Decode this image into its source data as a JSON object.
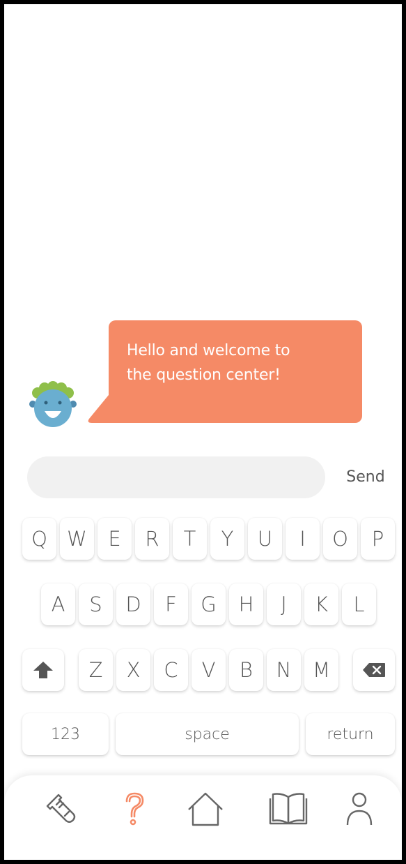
{
  "chat": {
    "bot_avatar_icon": "smiling-bot-avatar-icon",
    "bubble_line1": "Hello and welcome to",
    "bubble_line2": "the question center!",
    "bubble_color": "#f58a66"
  },
  "composer": {
    "input_value": "",
    "input_placeholder": "",
    "send_label": "Send"
  },
  "keyboard": {
    "row1": [
      "Q",
      "W",
      "E",
      "R",
      "T",
      "Y",
      "U",
      "I",
      "O",
      "P"
    ],
    "row2": [
      "A",
      "S",
      "D",
      "F",
      "G",
      "H",
      "J",
      "K",
      "L"
    ],
    "row3": [
      "Z",
      "X",
      "C",
      "V",
      "B",
      "N",
      "M"
    ],
    "shift_icon": "shift-icon",
    "backspace_icon": "backspace-icon",
    "numbers_label": "123",
    "space_label": "space",
    "return_label": "return"
  },
  "bottom_nav": {
    "items": [
      {
        "icon": "test-tube-icon",
        "active": false
      },
      {
        "icon": "question-mark-icon",
        "active": true
      },
      {
        "icon": "home-icon",
        "active": false
      },
      {
        "icon": "book-icon",
        "active": false
      },
      {
        "icon": "profile-icon",
        "active": false
      }
    ],
    "active_color": "#f58a66",
    "inactive_color": "#666666"
  }
}
